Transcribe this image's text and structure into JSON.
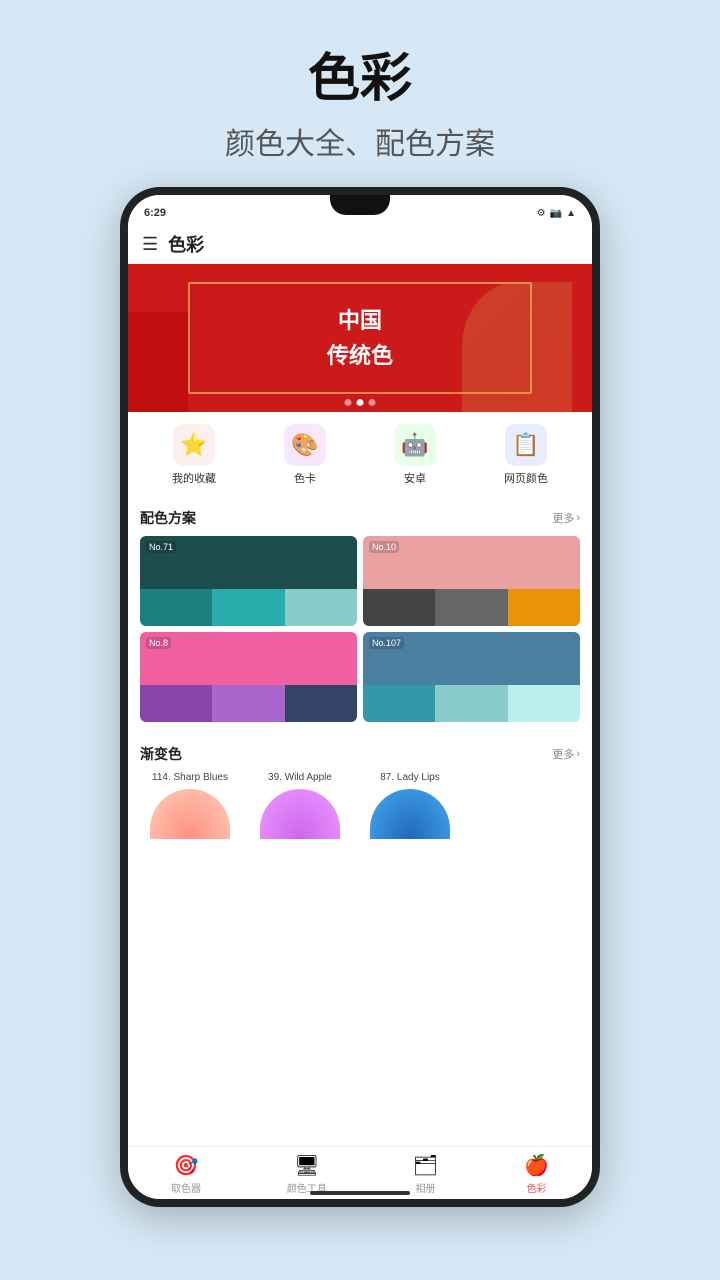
{
  "page": {
    "bg_title": "色彩",
    "bg_subtitle": "颜色大全、配色方案"
  },
  "status_bar": {
    "time": "6:29",
    "icons": [
      "⚙",
      "📷"
    ]
  },
  "app_header": {
    "title": "色彩"
  },
  "banner": {
    "line1": "中国",
    "line2": "传统色"
  },
  "categories": [
    {
      "id": "favorites",
      "icon": "⭐",
      "label": "我的收藏",
      "color": "#ff4444",
      "bg": "#fff0f0"
    },
    {
      "id": "card",
      "icon": "🎨",
      "label": "色卡",
      "color": "#cc44aa",
      "bg": "#f8e8ff"
    },
    {
      "id": "android",
      "icon": "🤖",
      "label": "安卓",
      "color": "#44aa44",
      "bg": "#e8ffe8"
    },
    {
      "id": "web",
      "icon": "📋",
      "label": "网页颜色",
      "color": "#4466cc",
      "bg": "#e8eeff"
    }
  ],
  "palette_section": {
    "title": "配色方案",
    "more": "更多"
  },
  "palettes": [
    {
      "id": "71",
      "num": "No.71",
      "top": "#1e4d4d",
      "swatches": [
        "#1a8080",
        "#2aacac",
        "#88cccc"
      ]
    },
    {
      "id": "10",
      "num": "No.10",
      "top": "#e8a0a0",
      "swatches": [
        "#444444",
        "#666666",
        "#e8930a"
      ]
    },
    {
      "id": "8",
      "num": "No.8",
      "top": "#f060a0",
      "swatches": [
        "#8844aa",
        "#aa66cc",
        "#334466"
      ]
    },
    {
      "id": "107",
      "num": "No.107",
      "top": "#4a7fa0",
      "swatches": [
        "#3399aa",
        "#88cccc",
        "#bbeeee"
      ]
    }
  ],
  "gradient_section": {
    "title": "渐变色",
    "more": "更多"
  },
  "gradients": [
    {
      "id": "114",
      "label": "114. Sharp Blues",
      "from": "#ff9080",
      "to": "#ffccbb"
    },
    {
      "id": "39",
      "label": "39. Wild Apple",
      "from": "#cc66ee",
      "to": "#ee99ff"
    },
    {
      "id": "87",
      "label": "87. Lady Lips",
      "from": "#2288cc",
      "to": "#44aaee"
    }
  ],
  "bottom_nav": [
    {
      "id": "picker",
      "icon": "🎯",
      "label": "取色器",
      "active": false
    },
    {
      "id": "tools",
      "icon": "🖥",
      "label": "颜色工具",
      "active": false
    },
    {
      "id": "album",
      "icon": "🗂",
      "label": "相册",
      "active": false
    },
    {
      "id": "color",
      "icon": "🍎",
      "label": "色彩",
      "active": true
    }
  ]
}
